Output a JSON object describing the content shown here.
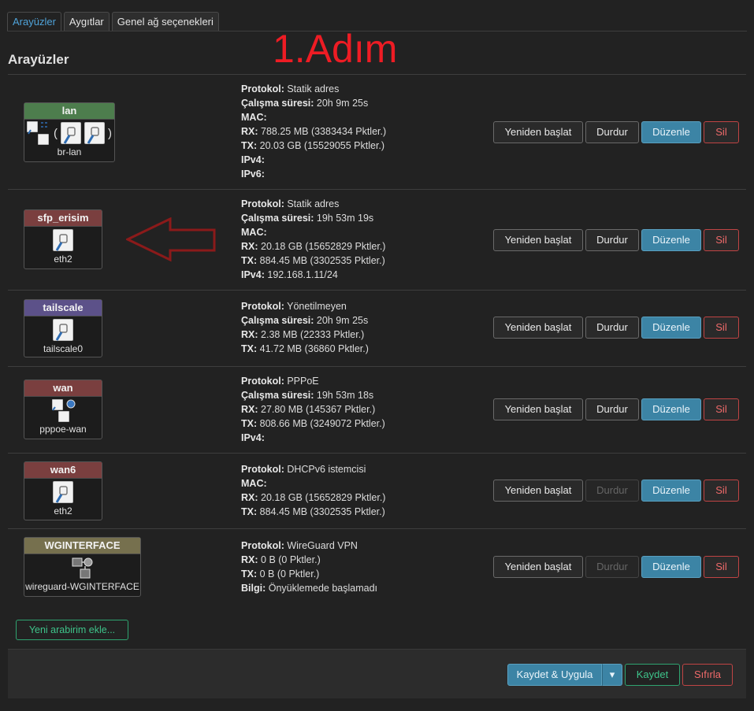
{
  "tabs": [
    "Arayüzler",
    "Aygıtlar",
    "Genel ağ seçenekleri"
  ],
  "annotation": "1.Adım",
  "section_title": "Arayüzler",
  "labels": {
    "protocol": "Protokol:",
    "uptime": "Çalışma süresi:",
    "mac": "MAC:",
    "rx": "RX:",
    "tx": "TX:",
    "ipv4": "IPv4:",
    "ipv6": "IPv6:",
    "info": "Bilgi:"
  },
  "buttons": {
    "restart": "Yeniden başlat",
    "stop": "Durdur",
    "edit": "Düzenle",
    "delete": "Sil"
  },
  "interfaces": [
    {
      "name": "lan",
      "device": "br-lan",
      "header_color": "#4d7d4d",
      "protocol": "Statik adres",
      "uptime": "20h 9m 25s",
      "mac": "",
      "rx": "788.25 MB (3383434 Pktler.)",
      "tx": "20.03 GB (15529055 Pktler.)",
      "ipv4": "",
      "ipv6": "",
      "stop_disabled": false
    },
    {
      "name": "sfp_erisim",
      "device": "eth2",
      "header_color": "#7a3f3f",
      "protocol": "Statik adres",
      "uptime": "19h 53m 19s",
      "mac": "",
      "rx": "20.18 GB (15652829 Pktler.)",
      "tx": "884.45 MB (3302535 Pktler.)",
      "ipv4": "192.168.1.11/24",
      "stop_disabled": false
    },
    {
      "name": "tailscale",
      "device": "tailscale0",
      "header_color": "#5c5189",
      "protocol": "Yönetilmeyen",
      "uptime": "20h 9m 25s",
      "rx": "2.38 MB (22333 Pktler.)",
      "tx": "41.72 MB (36860 Pktler.)",
      "stop_disabled": false
    },
    {
      "name": "wan",
      "device": "pppoe-wan",
      "header_color": "#7a3f3f",
      "protocol": "PPPoE",
      "uptime": "19h 53m 18s",
      "rx": "27.80 MB (145367 Pktler.)",
      "tx": "808.66 MB (3249072 Pktler.)",
      "ipv4": "",
      "stop_disabled": false
    },
    {
      "name": "wan6",
      "device": "eth2",
      "header_color": "#7a3f3f",
      "protocol": "DHCPv6 istemcisi",
      "mac": "",
      "rx": "20.18 GB (15652829 Pktler.)",
      "tx": "884.45 MB (3302535 Pktler.)",
      "stop_disabled": true
    },
    {
      "name": "WGINTERFACE",
      "device": "wireguard-WGINTERFACE",
      "header_color": "#76704e",
      "protocol": "WireGuard VPN",
      "rx": "0 B (0 Pktler.)",
      "tx": "0 B (0 Pktler.)",
      "info": "Önyüklemede başlamadı",
      "stop_disabled": true
    }
  ],
  "add_interface": "Yeni arabirim ekle...",
  "footer": {
    "save_apply": "Kaydet & Uygula",
    "save_apply_dropdown": "▾",
    "save": "Kaydet",
    "reset": "Sıfırla"
  }
}
